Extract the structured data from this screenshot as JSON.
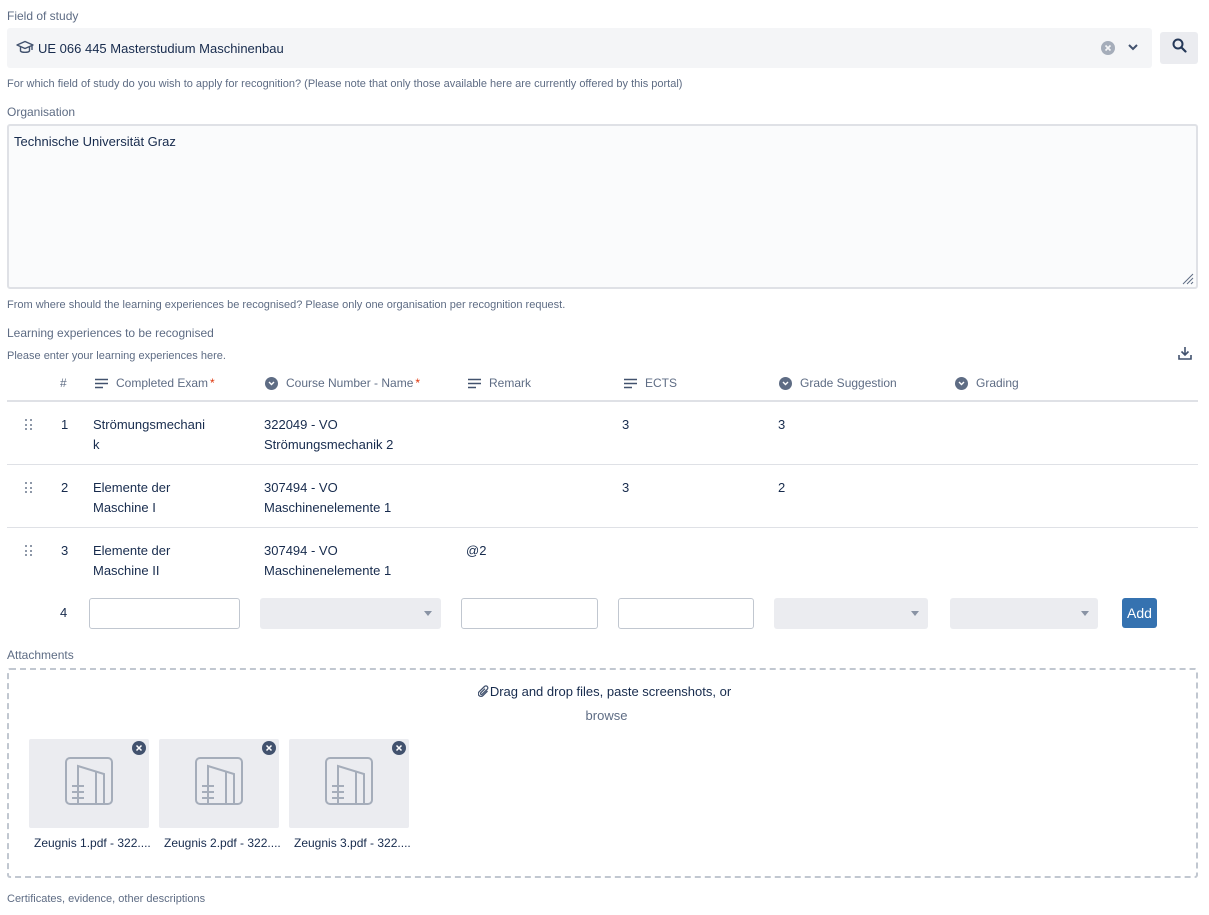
{
  "field_of_study": {
    "label": "Field of study",
    "value": "UE 066 445 Masterstudium Maschinenbau",
    "help": "For which field of study do you wish to apply for recognition? (Please note that only those available here are currently offered by this portal)"
  },
  "organisation": {
    "label": "Organisation",
    "value": "Technische Universität Graz",
    "help": "From where should the learning experiences be recognised? Please only one organisation per recognition request."
  },
  "learning": {
    "label": "Learning experiences to be recognised",
    "help": "Please enter your learning experiences here.",
    "columns": {
      "num": "#",
      "completed_exam": "Completed Exam",
      "course": "Course Number - Name",
      "remark": "Remark",
      "ects": "ECTS",
      "grade_suggestion": "Grade Suggestion",
      "grading": "Grading"
    },
    "required_mark": "*",
    "rows": [
      {
        "num": "1",
        "exam_l1": "Strömungsmechani",
        "exam_l2": "k",
        "course_l1": "322049 - VO",
        "course_l2": "Strömungsmechanik 2",
        "remark": "",
        "ects": "3",
        "grade": "3",
        "grading": ""
      },
      {
        "num": "2",
        "exam_l1": "Elemente der",
        "exam_l2": "Maschine I",
        "course_l1": "307494 - VO",
        "course_l2": "Maschinenelemente 1",
        "remark": "",
        "ects": "3",
        "grade": "2",
        "grading": ""
      },
      {
        "num": "3",
        "exam_l1": "Elemente der",
        "exam_l2": "Maschine II",
        "course_l1": "307494 - VO",
        "course_l2": "Maschinenelemente 1",
        "remark": "@2",
        "ects": "",
        "grade": "",
        "grading": ""
      }
    ],
    "new_row_num": "4",
    "add_label": "Add"
  },
  "attachments": {
    "label": "Attachments",
    "drop_text": "Drag and drop files, paste screenshots, or",
    "browse": "browse",
    "files": [
      {
        "name": "Zeugnis 1.pdf - 322...."
      },
      {
        "name": "Zeugnis 2.pdf - 322...."
      },
      {
        "name": "Zeugnis 3.pdf - 322...."
      }
    ],
    "help": "Certificates, evidence, other descriptions"
  }
}
